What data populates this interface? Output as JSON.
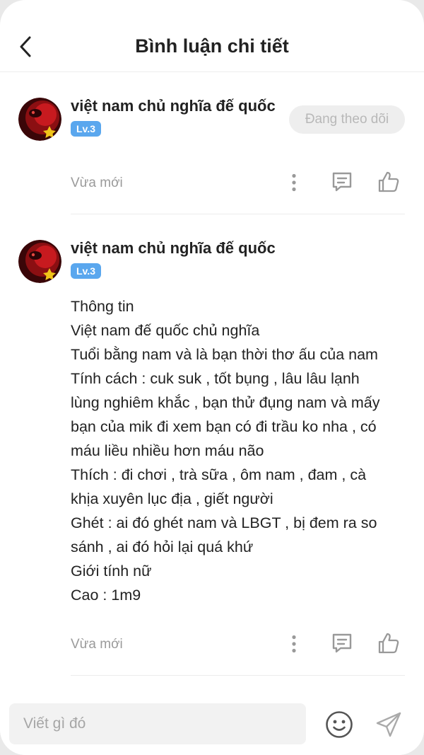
{
  "header": {
    "title": "Bình luận chi tiết"
  },
  "main_comment": {
    "username": "việt nam chủ nghĩa đế quốc",
    "level": "Lv.3",
    "follow_label": "Đang theo dõi",
    "time": "Vừa mới"
  },
  "reply": {
    "username": "việt nam chủ nghĩa đế quốc",
    "level": "Lv.3",
    "lines": [
      "Thông tin",
      "Việt nam đế quốc chủ nghĩa",
      "Tuổi bằng nam và là bạn thời thơ ấu của nam",
      "Tính cách : cuk suk , tốt bụng , lâu lâu lạnh",
      "lùng nghiêm khắc , bạn thử đụng nam và mấy",
      "bạn của mik đi xem bạn có đi trầu ko nha , có",
      "máu liều nhiều hơn máu não",
      "Thích : đi chơi , trà sữa , ôm nam , đam , cà",
      "khịa xuyên lục địa , giết người",
      "Ghét : ai đó ghét nam và LBGT , bị đem ra so",
      "sánh , ai đó hỏi lại quá khứ",
      "Giới tính nữ",
      "Cao : 1m9"
    ],
    "time": "Vừa mới"
  },
  "composer": {
    "placeholder": "Viết gì đó"
  },
  "icons": [
    "back-arrow-icon",
    "more-vertical-icon",
    "reply-comment-icon",
    "like-thumb-icon",
    "emoji-icon",
    "send-icon"
  ],
  "colors": {
    "badge": "#5aa7ee",
    "muted": "#9a9a9a",
    "icon": "#999999"
  }
}
